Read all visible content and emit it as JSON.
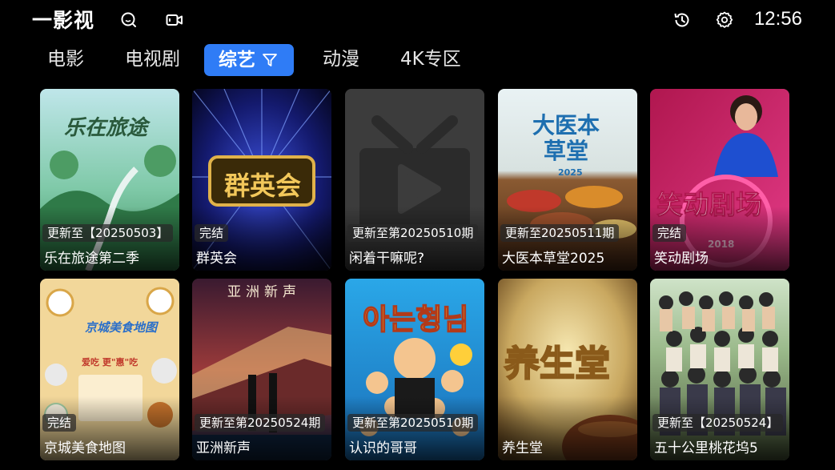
{
  "app": {
    "logo": "一影视",
    "time": "12:56"
  },
  "top_icons": [
    "search-icon",
    "video-camera-icon",
    "history-icon",
    "settings-icon"
  ],
  "tabs": [
    {
      "label": "电影",
      "active": false
    },
    {
      "label": "电视剧",
      "active": false
    },
    {
      "label": "综艺",
      "active": true,
      "icon": "filter-icon"
    },
    {
      "label": "动漫",
      "active": false
    },
    {
      "label": "4K专区",
      "active": false
    }
  ],
  "accent_color": "#2f7cf6",
  "items": [
    {
      "title": "乐在旅途第二季",
      "badge": "更新至【20250503】",
      "poster_text": "乐在旅途"
    },
    {
      "title": "群英会",
      "badge": "完结",
      "poster_text": "群英会"
    },
    {
      "title": "闲着干嘛呢?",
      "badge": "更新至第20250510期",
      "poster_text": ""
    },
    {
      "title": "大医本草堂2025",
      "badge": "更新至20250511期",
      "poster_text": "大医本草堂",
      "poster_sub": "2025"
    },
    {
      "title": "笑动剧场",
      "badge": "完结",
      "poster_text": "笑动剧场",
      "poster_sub": "2018"
    },
    {
      "title": "京城美食地图",
      "badge": "完结",
      "poster_text": "京城美食地图",
      "poster_sub": "爱吃 更\"惠\"吃"
    },
    {
      "title": "亚洲新声",
      "badge": "更新至第20250524期",
      "poster_text": "亚洲新声"
    },
    {
      "title": "认识的哥哥",
      "badge": "更新至第20250510期",
      "poster_text": "아는형님"
    },
    {
      "title": "养生堂",
      "badge": "",
      "poster_text": "养生堂"
    },
    {
      "title": "五十公里桃花坞5",
      "badge": "更新至【20250524】",
      "poster_text": ""
    }
  ]
}
